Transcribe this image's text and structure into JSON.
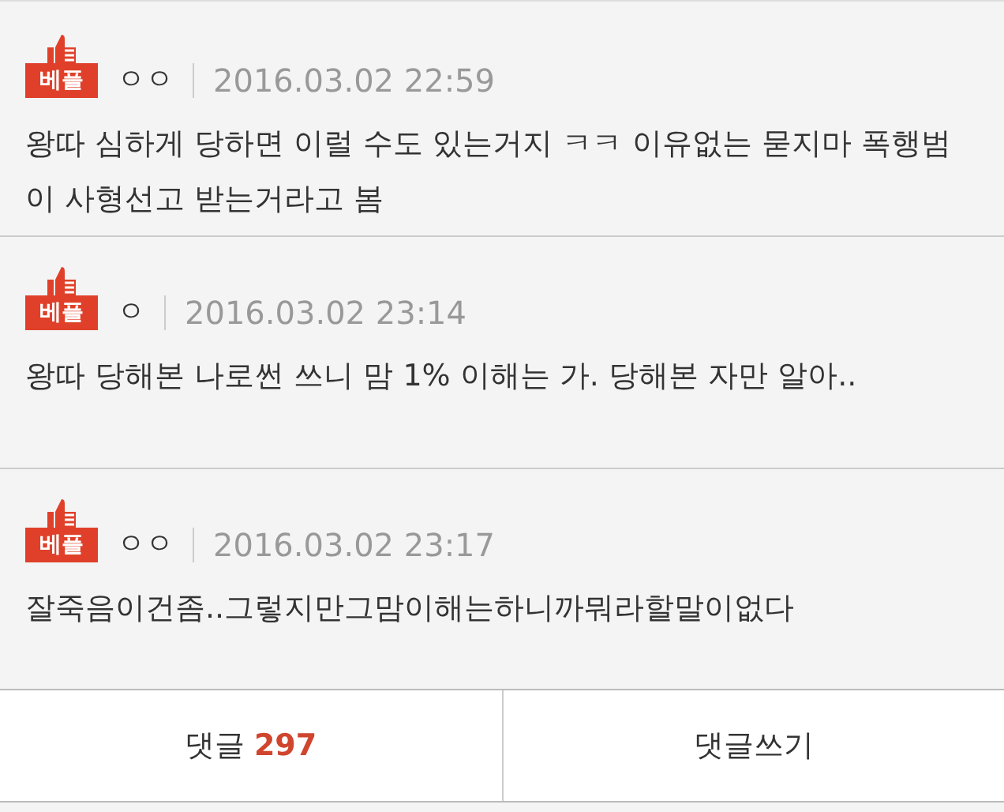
{
  "comments": [
    {
      "badge": "베플",
      "author": "ㅇㅇ",
      "time": "2016.03.02 22:59",
      "text": "왕따 심하게 당하면 이럴 수도 있는거지 ㅋㅋ 이유없는 묻지마 폭행범이 사형선고 받는거라고 봄"
    },
    {
      "badge": "베플",
      "author": "ㅇ",
      "time": "2016.03.02 23:14",
      "text": "왕따 당해본 나로썬 쓰니 맘 1% 이해는 가. 당해본 자만 알아.."
    },
    {
      "badge": "베플",
      "author": "ㅇㅇ",
      "time": "2016.03.02 23:17",
      "text": "잘죽음이건좀..그렇지만그맘이해는하니까뭐라할말이없다"
    }
  ],
  "footer": {
    "comments_label": "댓글",
    "comments_count": "297",
    "write_label": "댓글쓰기"
  }
}
